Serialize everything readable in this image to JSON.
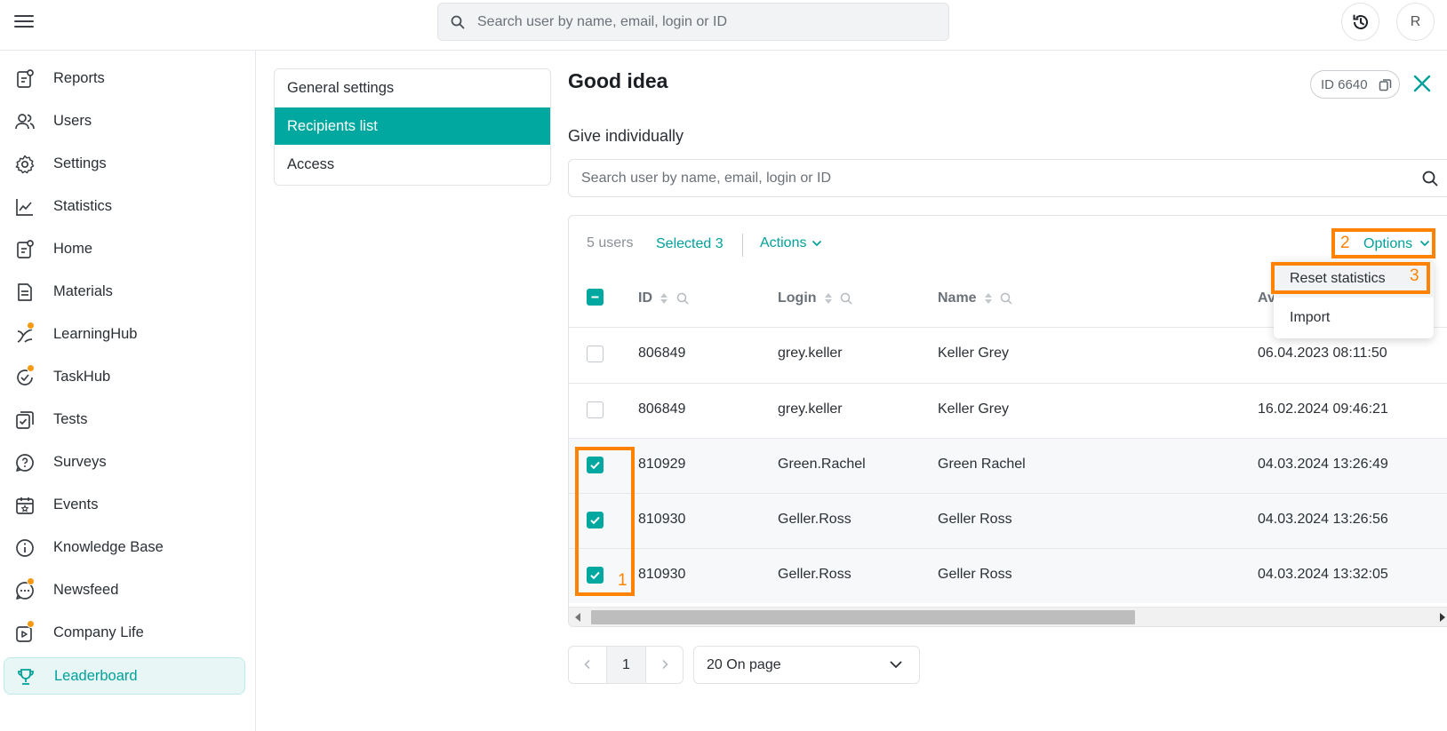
{
  "topbar": {
    "search_placeholder": "Search user by name, email, login or ID",
    "avatar_initial": "R"
  },
  "sidebar": {
    "items": [
      {
        "label": "Reports",
        "icon": "report-icon",
        "badge": false,
        "active": false
      },
      {
        "label": "Users",
        "icon": "users-icon",
        "badge": false,
        "active": false
      },
      {
        "label": "Settings",
        "icon": "gear-icon",
        "badge": false,
        "active": false
      },
      {
        "label": "Statistics",
        "icon": "chart-line-icon",
        "badge": false,
        "active": false
      },
      {
        "label": "Home",
        "icon": "home-icon",
        "badge": false,
        "active": false
      },
      {
        "label": "Materials",
        "icon": "document-icon",
        "badge": false,
        "active": false
      },
      {
        "label": "LearningHub",
        "icon": "learning-icon",
        "badge": true,
        "active": false
      },
      {
        "label": "TaskHub",
        "icon": "task-icon",
        "badge": true,
        "active": false
      },
      {
        "label": "Tests",
        "icon": "tests-icon",
        "badge": false,
        "active": false
      },
      {
        "label": "Surveys",
        "icon": "survey-icon",
        "badge": false,
        "active": false
      },
      {
        "label": "Events",
        "icon": "calendar-icon",
        "badge": false,
        "active": false
      },
      {
        "label": "Knowledge Base",
        "icon": "info-icon",
        "badge": false,
        "active": false
      },
      {
        "label": "Newsfeed",
        "icon": "chat-icon",
        "badge": true,
        "active": false
      },
      {
        "label": "Company Life",
        "icon": "play-icon",
        "badge": true,
        "active": false
      },
      {
        "label": "Leaderboard",
        "icon": "trophy-icon",
        "badge": false,
        "active": true
      }
    ]
  },
  "subnav": {
    "items": [
      {
        "label": "General settings",
        "active": false
      },
      {
        "label": "Recipients list",
        "active": true
      },
      {
        "label": "Access",
        "active": false
      }
    ]
  },
  "main": {
    "title": "Good idea",
    "id_label": "ID 6640",
    "subtitle": "Give individually",
    "search_placeholder": "Search user by name, email, login or ID"
  },
  "table": {
    "count_label": "5 users",
    "selected_label": "Selected 3",
    "actions_label": "Actions",
    "options_label": "Options",
    "columns": [
      "ID",
      "Login",
      "Name",
      "Av"
    ],
    "rows": [
      {
        "id": "806849",
        "login": "grey.keller",
        "name": "Keller Grey",
        "date": "06.04.2023 08:11:50",
        "checked": false
      },
      {
        "id": "806849",
        "login": "grey.keller",
        "name": "Keller Grey",
        "date": "16.02.2024 09:46:21",
        "checked": false
      },
      {
        "id": "810929",
        "login": "Green.Rachel",
        "name": "Green Rachel",
        "date": "04.03.2024 13:26:49",
        "checked": true
      },
      {
        "id": "810930",
        "login": "Geller.Ross",
        "name": "Geller Ross",
        "date": "04.03.2024 13:26:56",
        "checked": true
      },
      {
        "id": "810930",
        "login": "Geller.Ross",
        "name": "Geller Ross",
        "date": "04.03.2024 13:32:05",
        "checked": true
      }
    ]
  },
  "options_menu": {
    "items": [
      "Reset statistics",
      "Import"
    ]
  },
  "pagination": {
    "current_page": "1",
    "per_page": "20 On page"
  },
  "annotations": {
    "marker_1": "1",
    "marker_2": "2",
    "marker_3": "3",
    "color": "#ff8200"
  },
  "colors": {
    "accent": "#00a8a0",
    "badge": "#f59a10"
  }
}
